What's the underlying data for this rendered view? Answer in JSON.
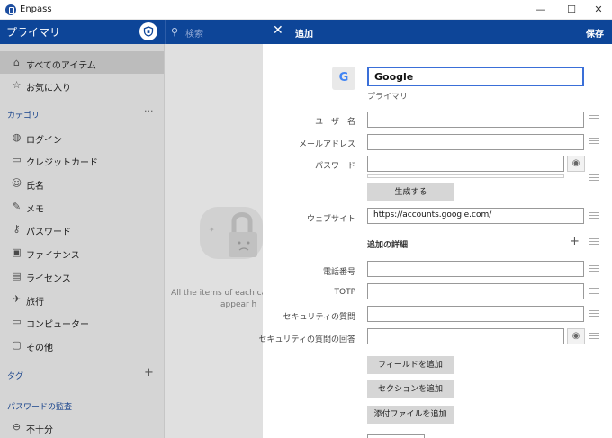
{
  "window": {
    "title": "Enpass",
    "minimize": "—",
    "maximize": "☐",
    "close": "✕"
  },
  "header": {
    "vault_name": "プライマリ",
    "search_placeholder": "検索",
    "panel_title": "追加",
    "save_label": "保存"
  },
  "sidebar": {
    "items_top": [
      {
        "label": "すべてのアイテム",
        "icon": "home-icon",
        "active": true
      },
      {
        "label": "お気に入り",
        "icon": "star-icon",
        "active": false
      }
    ],
    "category_heading": "カテゴリ",
    "category_menu": "···",
    "categories": [
      {
        "label": "ログイン",
        "icon": "globe-icon"
      },
      {
        "label": "クレジットカード",
        "icon": "credit-card-icon"
      },
      {
        "label": "氏名",
        "icon": "person-icon"
      },
      {
        "label": "メモ",
        "icon": "note-icon"
      },
      {
        "label": "パスワード",
        "icon": "key-icon"
      },
      {
        "label": "ファイナンス",
        "icon": "finance-icon"
      },
      {
        "label": "ライセンス",
        "icon": "license-icon"
      },
      {
        "label": "旅行",
        "icon": "plane-icon"
      },
      {
        "label": "コンピューター",
        "icon": "computer-icon"
      },
      {
        "label": "その他",
        "icon": "box-icon"
      }
    ],
    "tag_heading": "タグ",
    "tag_add": "+",
    "audit_heading": "パスワードの監査",
    "audit_items": [
      {
        "label": "不十分",
        "icon": "minus-circle-icon"
      }
    ]
  },
  "middle": {
    "empty_line1": "All the items of each cat",
    "empty_line2": "appear h"
  },
  "form": {
    "icon_letter": "G",
    "name_value": "Google",
    "vault_tag": "プライマリ",
    "fields": [
      {
        "label": "ユーザー名",
        "value": ""
      },
      {
        "label": "メールアドレス",
        "value": ""
      },
      {
        "label": "パスワード",
        "value": ""
      }
    ],
    "generate_button": "生成する",
    "website": {
      "label": "ウェブサイト",
      "value": "https://accounts.google.com/"
    },
    "details_heading": "追加の詳細",
    "details_add": "+",
    "detail_fields": [
      {
        "label": "電話番号",
        "value": ""
      },
      {
        "label": "TOTP",
        "value": ""
      },
      {
        "label": "セキュリティの質問",
        "value": ""
      },
      {
        "label": "セキュリティの質問の回答",
        "value": ""
      }
    ],
    "buttons": {
      "add_field": "フィールドを追加",
      "add_section": "セクションを追加",
      "add_attachment": "添付ファイルを追加"
    }
  },
  "colors": {
    "header_blue": "#0d4598",
    "accent_border": "#3a6fd8",
    "section_text": "#1d4ea0"
  }
}
